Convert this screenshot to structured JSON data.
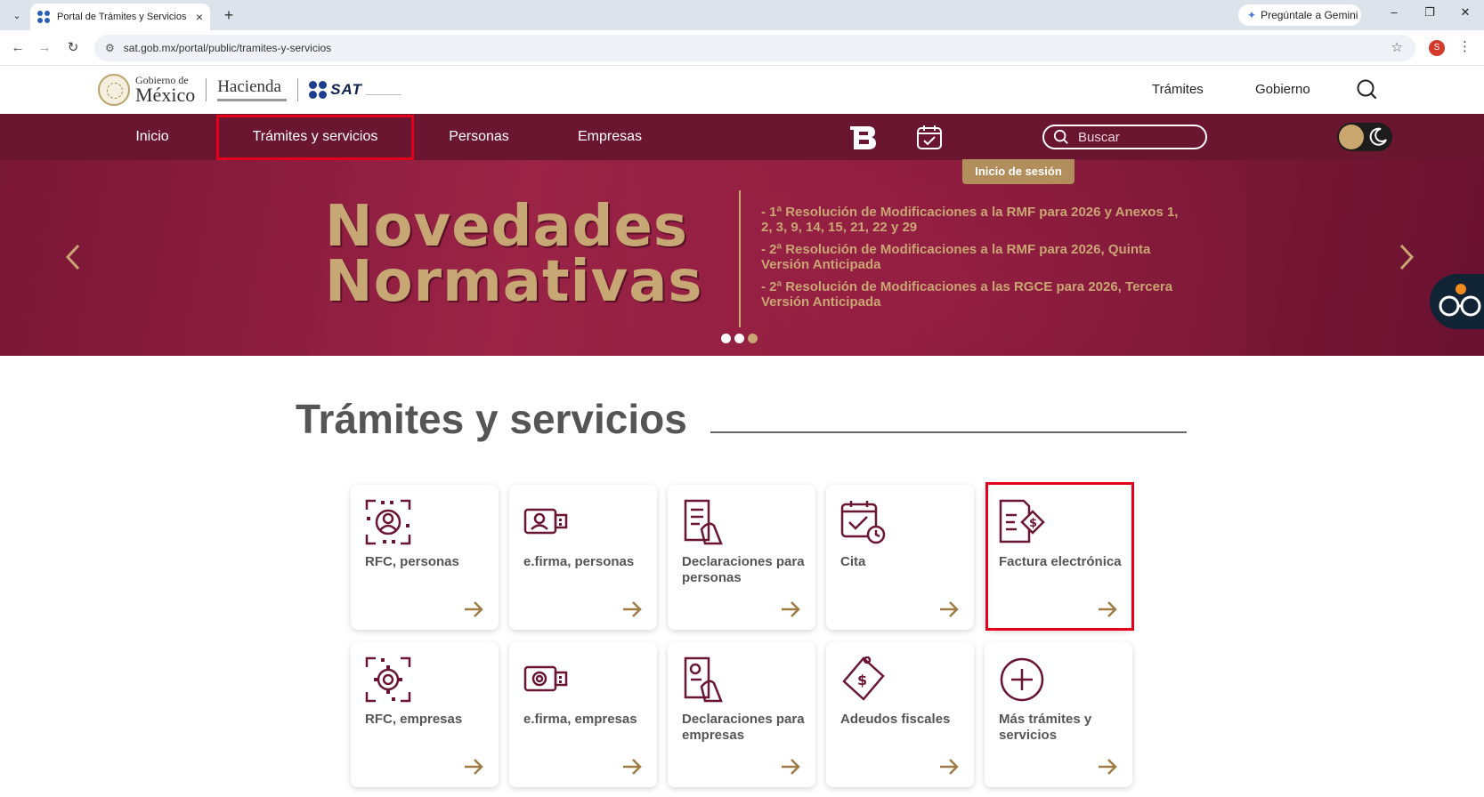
{
  "browser": {
    "tab_title": "Portal de Trámites y Servicios d",
    "new_tab": "+",
    "gemini": "Pregúntale a Gemini",
    "url": "sat.gob.mx/portal/public/tramites-y-servicios",
    "profile_initial": "S",
    "icons": [
      "tab-search-icon",
      "back-icon",
      "forward-icon",
      "reload-icon",
      "site-settings-icon",
      "bookmark-star-icon",
      "kebab-menu-icon"
    ]
  },
  "header": {
    "gob_small": "Gobierno de",
    "gob_big": "México",
    "hacienda": "Hacienda",
    "sat": "SAT",
    "links": [
      "Trámites",
      "Gobierno"
    ]
  },
  "nav": {
    "items": [
      "Inicio",
      "Trámites y servicios",
      "Personas",
      "Empresas"
    ],
    "search_placeholder": "Buscar",
    "session": "Inicio de sesión"
  },
  "banner": {
    "title_line1": "Novedades",
    "title_line2": "Normativas",
    "items": [
      "- 1ª Resolución de Modificaciones a la RMF para 2026 y Anexos 1, 2, 3, 9, 14, 15, 21, 22 y 29",
      "- 2ª Resolución de Modificaciones a la RMF para 2026, Quinta Versión Anticipada",
      "- 2ª Resolución de Modificaciones a las RGCE para 2026, Tercera Versión Anticipada"
    ]
  },
  "section": {
    "title": "Trámites y servicios"
  },
  "cards": [
    {
      "label": "RFC, personas",
      "icon": "rfc-person-icon"
    },
    {
      "label": "e.firma, personas",
      "icon": "efirma-person-icon"
    },
    {
      "label": "Declaraciones para personas",
      "icon": "declaration-icon"
    },
    {
      "label": "Cita",
      "icon": "calendar-check-icon"
    },
    {
      "label": "Factura electrónica",
      "icon": "invoice-icon"
    },
    {
      "label": "RFC, empresas",
      "icon": "rfc-company-icon"
    },
    {
      "label": "e.firma, empresas",
      "icon": "efirma-company-icon"
    },
    {
      "label": "Declaraciones para empresas",
      "icon": "declaration-company-icon"
    },
    {
      "label": "Adeudos fiscales",
      "icon": "debt-icon"
    },
    {
      "label": "Más trámites y servicios",
      "icon": "plus-circle-icon"
    }
  ],
  "colors": {
    "nav_bg": "#6b1631",
    "banner_gold": "#c9a673",
    "icon_maroon": "#6b1631",
    "arrow_gold": "#a07c45",
    "highlight_red": "#e4001a"
  }
}
